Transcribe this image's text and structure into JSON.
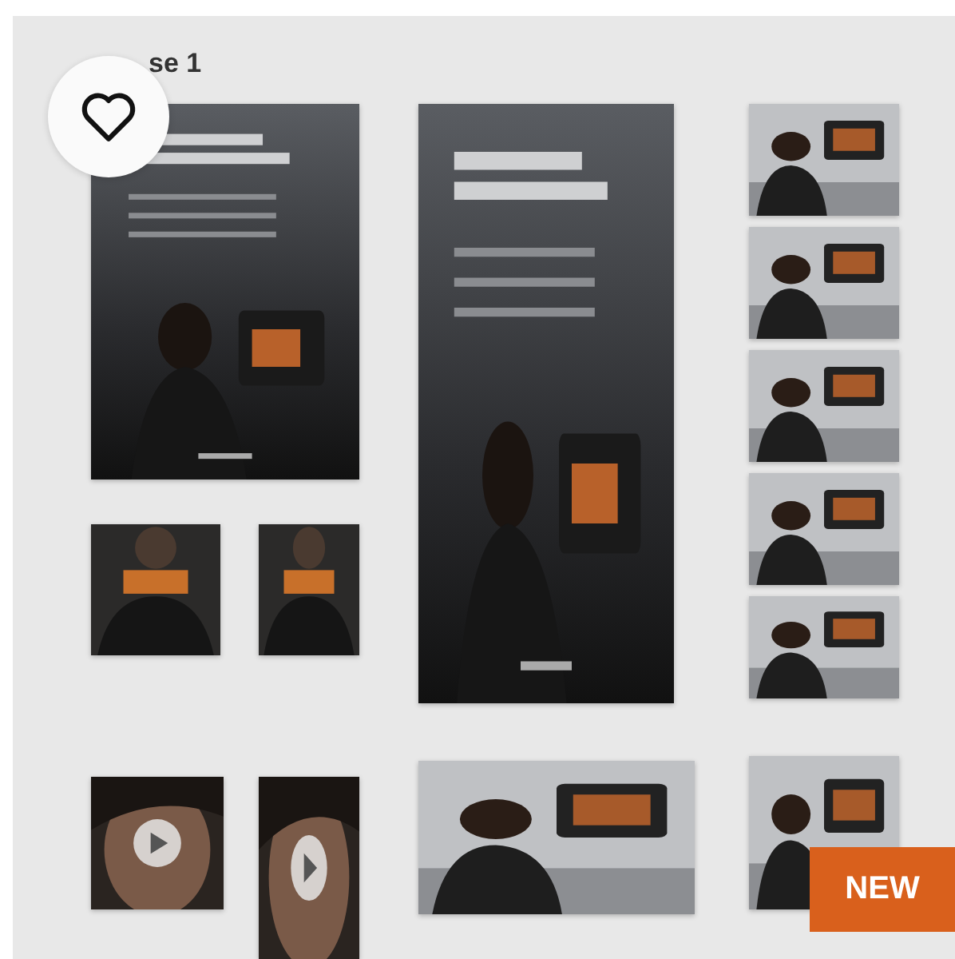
{
  "heading": "se 1",
  "favorite": {
    "selected": false
  },
  "badge": "NEW"
}
